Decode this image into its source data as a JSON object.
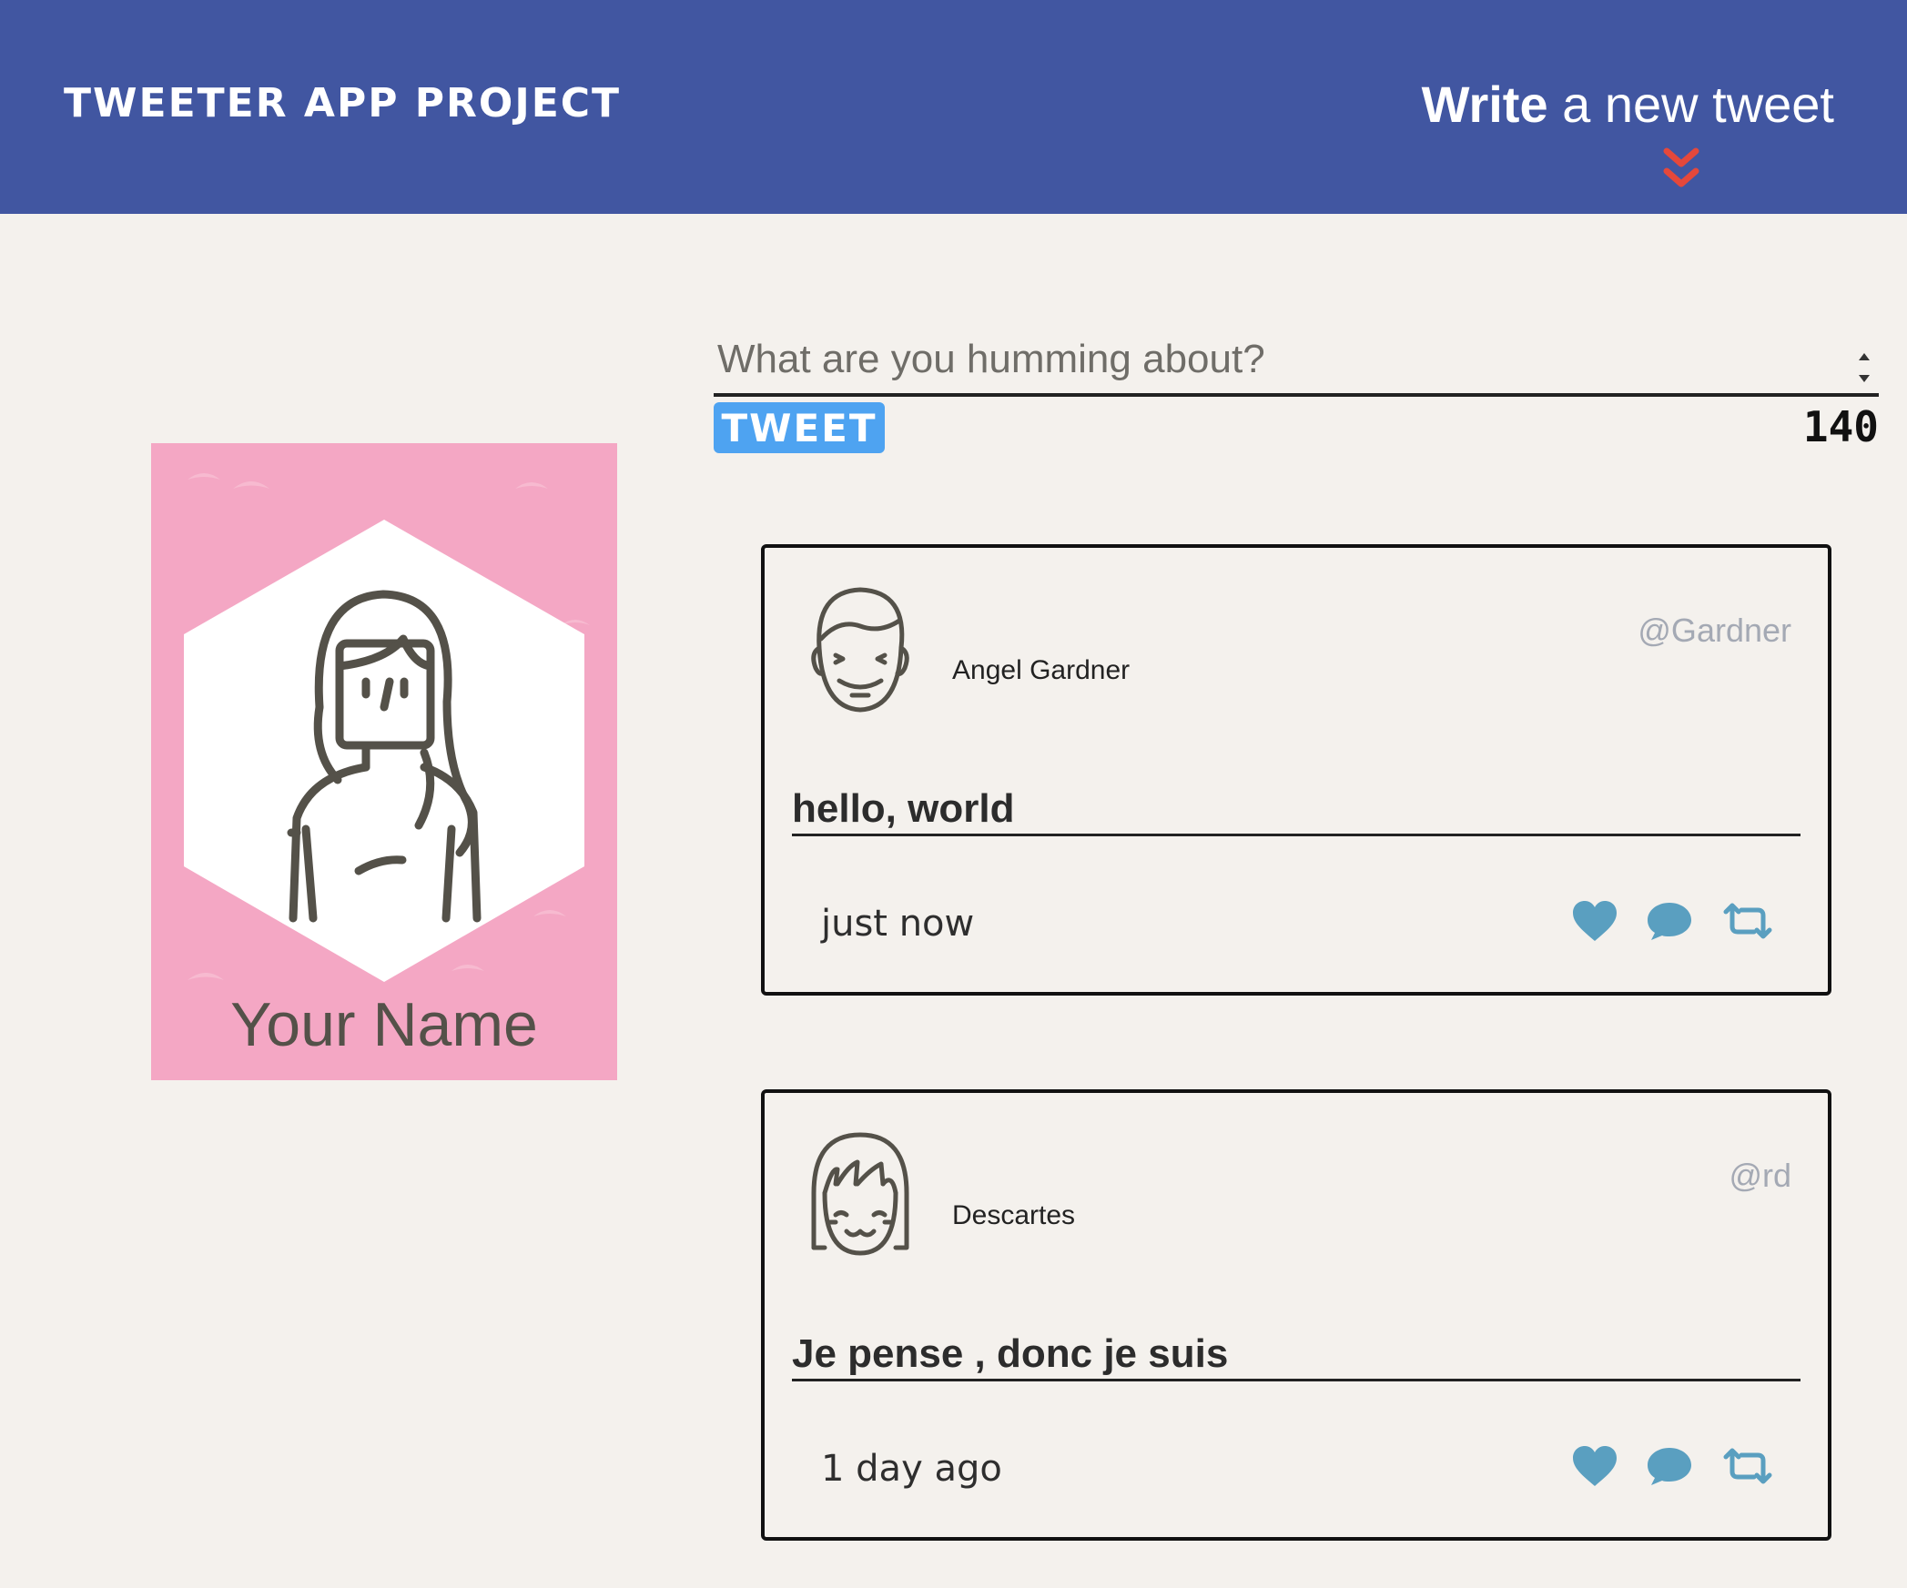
{
  "nav": {
    "brand": "TWEETER APP PROJECT",
    "compose_bold": "Write",
    "compose_rest": " a new tweet",
    "chevron_icon": "double-chevron-down-icon",
    "chevron_color": "#e5483b"
  },
  "profile": {
    "name": "Your Name",
    "background_color": "#f4a7c4"
  },
  "compose": {
    "placeholder": "What are you humming about?",
    "button_label": "TWEET",
    "button_color": "#4ea3f1",
    "counter": "140"
  },
  "tweets": [
    {
      "author": "Angel Gardner",
      "handle": "@Gardner",
      "text": "hello, world",
      "time": "just now"
    },
    {
      "author": "Descartes",
      "handle": "@rd",
      "text": "Je pense , donc je suis",
      "time": "1 day ago"
    }
  ],
  "action_icons": [
    "heart-icon",
    "comment-icon",
    "retweet-icon"
  ],
  "action_color": "#5a9fc0",
  "header_color": "#4156a1"
}
